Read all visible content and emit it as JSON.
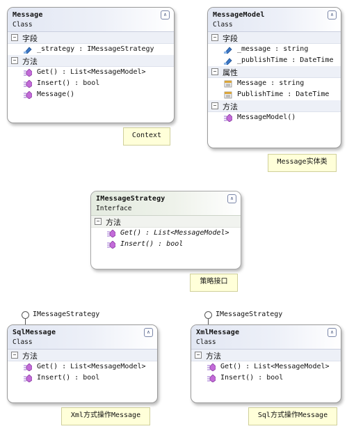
{
  "icon_names": {
    "field": "field-icon",
    "property": "property-icon",
    "method": "method-icon"
  },
  "message": {
    "name": "Message",
    "stereotype": "Class",
    "sections": [
      {
        "label": "字段",
        "members": [
          "_strategy : IMessageStrategy"
        ]
      },
      {
        "label": "方法",
        "members": [
          "Get() : List<MessageModel>",
          "Insert() : bool",
          "Message()"
        ]
      }
    ],
    "note": "Context"
  },
  "message_model": {
    "name": "MessageModel",
    "stereotype": "Class",
    "sections": [
      {
        "label": "字段",
        "members": [
          "_message : string",
          "_publishTime : DateTime"
        ]
      },
      {
        "label": "属性",
        "members": [
          "Message : string",
          "PublishTime : DateTime"
        ]
      },
      {
        "label": "方法",
        "members": [
          "MessageModel()"
        ]
      }
    ],
    "note": "Message实体类"
  },
  "imessage_strategy": {
    "name": "IMessageStrategy",
    "stereotype": "Interface",
    "sections": [
      {
        "label": "方法",
        "members": [
          "Get() : List<MessageModel>",
          "Insert() : bool"
        ]
      }
    ],
    "note": "策略接口"
  },
  "sql_message": {
    "name": "SqlMessage",
    "stereotype": "Class",
    "implements": "IMessageStrategy",
    "sections": [
      {
        "label": "方法",
        "members": [
          "Get() : List<MessageModel>",
          "Insert() : bool"
        ]
      }
    ],
    "note": "Xml方式操作Message"
  },
  "xml_message": {
    "name": "XmlMessage",
    "stereotype": "Class",
    "implements": "IMessageStrategy",
    "sections": [
      {
        "label": "方法",
        "members": [
          "Get() : List<MessageModel>",
          "Insert() : bool"
        ]
      }
    ],
    "note": "Sql方式操作Message"
  }
}
